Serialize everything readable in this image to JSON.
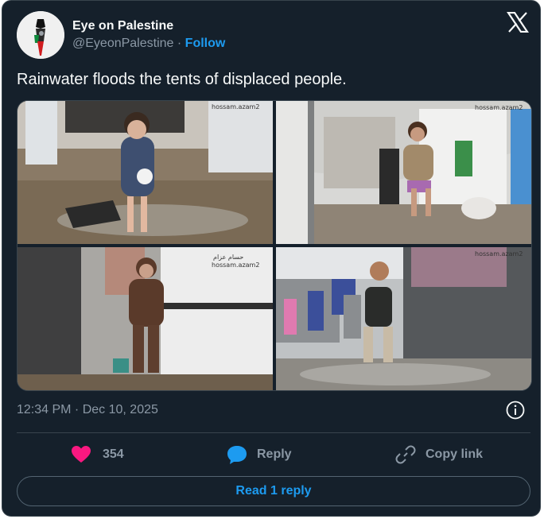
{
  "author": {
    "name": "Eye on Palestine",
    "handle": "@EyeonPalestine",
    "separator": "·",
    "follow_label": "Follow"
  },
  "tweet": {
    "text": "Rainwater floods the tents of displaced people.",
    "timestamp": "12:34 PM · Dec 10, 2025"
  },
  "media": {
    "watermarks": [
      "hossam.azam2",
      "hossam.azam2",
      "حسام عزام",
      "hossam.azam2",
      "hossam.azam2"
    ],
    "photo_count": 4
  },
  "actions": {
    "like_count": "354",
    "reply_label": "Reply",
    "copy_link_label": "Copy link"
  },
  "read_replies_label": "Read 1 reply",
  "colors": {
    "background": "#15202b",
    "accent": "#1d9bf0",
    "like": "#f91880",
    "muted": "#8b98a5",
    "text": "#f7f9f9"
  },
  "icons": [
    "x-logo-icon",
    "info-icon",
    "heart-icon",
    "reply-bubble-icon",
    "link-icon"
  ]
}
